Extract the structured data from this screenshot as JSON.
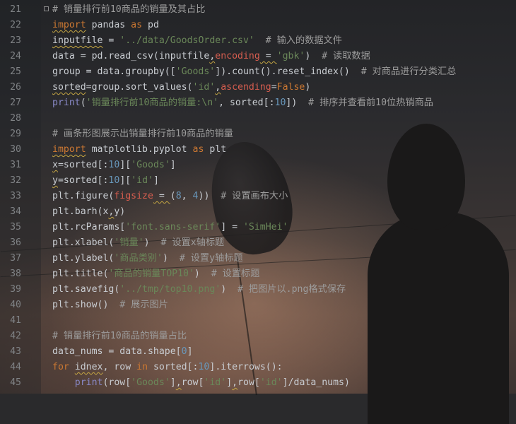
{
  "editor": {
    "lines": [
      {
        "n": "21",
        "tokens": [
          {
            "t": "# 销量排行前10商品的销量及其占比",
            "c": "cmt"
          }
        ]
      },
      {
        "n": "22",
        "tokens": [
          {
            "t": "import",
            "c": "kw wavy"
          },
          {
            "t": " pandas ",
            "c": "plain"
          },
          {
            "t": "as",
            "c": "kw"
          },
          {
            "t": " pd",
            "c": "plain"
          }
        ]
      },
      {
        "n": "23",
        "tokens": [
          {
            "t": "inputfile",
            "c": "plain wavy"
          },
          {
            "t": " = ",
            "c": "plain"
          },
          {
            "t": "'../data/GoodsOrder.csv'",
            "c": "str"
          },
          {
            "t": "  # 输入的数据文件",
            "c": "cmt"
          }
        ]
      },
      {
        "n": "24",
        "tokens": [
          {
            "t": "data = pd.read_csv(inputfile",
            "c": "plain"
          },
          {
            "t": ",",
            "c": "plain wavy"
          },
          {
            "t": "encoding",
            "c": "prm"
          },
          {
            "t": " = ",
            "c": "plain wavy"
          },
          {
            "t": "'gbk'",
            "c": "str"
          },
          {
            "t": ")  ",
            "c": "plain"
          },
          {
            "t": "# 读取数据",
            "c": "cmt"
          }
        ]
      },
      {
        "n": "25",
        "tokens": [
          {
            "t": "group = data.groupby([",
            "c": "plain"
          },
          {
            "t": "'Goods'",
            "c": "str"
          },
          {
            "t": "]).count().reset_index()  ",
            "c": "plain"
          },
          {
            "t": "# 对商品进行分类汇总",
            "c": "cmt"
          }
        ]
      },
      {
        "n": "26",
        "tokens": [
          {
            "t": "sorted",
            "c": "plain wavy"
          },
          {
            "t": "=group.sort_values(",
            "c": "plain"
          },
          {
            "t": "'id'",
            "c": "str"
          },
          {
            "t": ",",
            "c": "plain wavy"
          },
          {
            "t": "ascending",
            "c": "prm"
          },
          {
            "t": "=",
            "c": "plain"
          },
          {
            "t": "False",
            "c": "kw"
          },
          {
            "t": ")",
            "c": "plain"
          }
        ]
      },
      {
        "n": "27",
        "tokens": [
          {
            "t": "print",
            "c": "bi"
          },
          {
            "t": "(",
            "c": "plain"
          },
          {
            "t": "'销量排行前10商品的销量:\\n'",
            "c": "str"
          },
          {
            "t": ", sorted[:",
            "c": "plain"
          },
          {
            "t": "10",
            "c": "num"
          },
          {
            "t": "])  ",
            "c": "plain"
          },
          {
            "t": "# 排序并查看前10位热销商品",
            "c": "cmt"
          }
        ]
      },
      {
        "n": "28",
        "tokens": []
      },
      {
        "n": "29",
        "tokens": [
          {
            "t": "# 画条形图展示出销量排行前10商品的销量",
            "c": "cmt"
          }
        ]
      },
      {
        "n": "30",
        "tokens": [
          {
            "t": "import",
            "c": "kw wavy"
          },
          {
            "t": " matplotlib.pyplot ",
            "c": "plain"
          },
          {
            "t": "as",
            "c": "kw"
          },
          {
            "t": " plt",
            "c": "plain"
          }
        ]
      },
      {
        "n": "31",
        "tokens": [
          {
            "t": "x",
            "c": "plain wavy"
          },
          {
            "t": "=sorted[:",
            "c": "plain"
          },
          {
            "t": "10",
            "c": "num"
          },
          {
            "t": "][",
            "c": "plain"
          },
          {
            "t": "'Goods'",
            "c": "str"
          },
          {
            "t": "]",
            "c": "plain"
          }
        ]
      },
      {
        "n": "32",
        "tokens": [
          {
            "t": "y",
            "c": "plain wavy"
          },
          {
            "t": "=sorted[:",
            "c": "plain"
          },
          {
            "t": "10",
            "c": "num"
          },
          {
            "t": "][",
            "c": "plain"
          },
          {
            "t": "'id'",
            "c": "str"
          },
          {
            "t": "]",
            "c": "plain"
          }
        ]
      },
      {
        "n": "33",
        "tokens": [
          {
            "t": "plt.figure(",
            "c": "plain"
          },
          {
            "t": "figsize",
            "c": "prm"
          },
          {
            "t": " = ",
            "c": "plain wavy"
          },
          {
            "t": "(",
            "c": "plain"
          },
          {
            "t": "8",
            "c": "num"
          },
          {
            "t": ", ",
            "c": "plain"
          },
          {
            "t": "4",
            "c": "num"
          },
          {
            "t": "))  ",
            "c": "plain"
          },
          {
            "t": "# 设置画布大小",
            "c": "cmt"
          }
        ]
      },
      {
        "n": "34",
        "tokens": [
          {
            "t": "plt.barh(x",
            "c": "plain"
          },
          {
            "t": ",",
            "c": "plain wavy"
          },
          {
            "t": "y)",
            "c": "plain"
          }
        ]
      },
      {
        "n": "35",
        "tokens": [
          {
            "t": "plt.rcParams[",
            "c": "plain"
          },
          {
            "t": "'font.sans-serif'",
            "c": "str"
          },
          {
            "t": "] = ",
            "c": "plain"
          },
          {
            "t": "'SimHei'",
            "c": "str"
          }
        ]
      },
      {
        "n": "36",
        "tokens": [
          {
            "t": "plt.xlabel(",
            "c": "plain"
          },
          {
            "t": "'销量'",
            "c": "str"
          },
          {
            "t": ")  ",
            "c": "plain"
          },
          {
            "t": "# 设置x轴标题",
            "c": "cmt"
          }
        ]
      },
      {
        "n": "37",
        "tokens": [
          {
            "t": "plt.ylabel(",
            "c": "plain"
          },
          {
            "t": "'商品类别'",
            "c": "str"
          },
          {
            "t": ")  ",
            "c": "plain"
          },
          {
            "t": "# 设置y轴标题",
            "c": "cmt"
          }
        ]
      },
      {
        "n": "38",
        "tokens": [
          {
            "t": "plt.title(",
            "c": "plain"
          },
          {
            "t": "'商品的销量TOP10'",
            "c": "str"
          },
          {
            "t": ")  ",
            "c": "plain"
          },
          {
            "t": "# 设置标题",
            "c": "cmt"
          }
        ]
      },
      {
        "n": "39",
        "tokens": [
          {
            "t": "plt.savefig(",
            "c": "plain"
          },
          {
            "t": "'../tmp/top10.png'",
            "c": "str"
          },
          {
            "t": ")  ",
            "c": "plain"
          },
          {
            "t": "# 把图片以.png格式保存",
            "c": "cmt"
          }
        ]
      },
      {
        "n": "40",
        "tokens": [
          {
            "t": "plt.show()  ",
            "c": "plain"
          },
          {
            "t": "# 展示图片",
            "c": "cmt"
          }
        ]
      },
      {
        "n": "41",
        "tokens": []
      },
      {
        "n": "42",
        "tokens": [
          {
            "t": "# 销量排行前10商品的销量占比",
            "c": "cmt"
          }
        ]
      },
      {
        "n": "43",
        "tokens": [
          {
            "t": "data_nums = data.shape[",
            "c": "plain"
          },
          {
            "t": "0",
            "c": "num"
          },
          {
            "t": "]",
            "c": "plain"
          }
        ]
      },
      {
        "n": "44",
        "tokens": [
          {
            "t": "for",
            "c": "kw"
          },
          {
            "t": " ",
            "c": "plain"
          },
          {
            "t": "idnex",
            "c": "plain wavy"
          },
          {
            "t": ", row ",
            "c": "plain"
          },
          {
            "t": "in",
            "c": "kw"
          },
          {
            "t": " sorted[:",
            "c": "plain"
          },
          {
            "t": "10",
            "c": "num"
          },
          {
            "t": "].iterrows():",
            "c": "plain"
          }
        ]
      },
      {
        "n": "45",
        "tokens": [
          {
            "t": "    ",
            "c": "plain"
          },
          {
            "t": "print",
            "c": "bi"
          },
          {
            "t": "(row[",
            "c": "plain"
          },
          {
            "t": "'Goods'",
            "c": "str"
          },
          {
            "t": "]",
            "c": "plain"
          },
          {
            "t": ",",
            "c": "plain wavy"
          },
          {
            "t": "row[",
            "c": "plain"
          },
          {
            "t": "'id'",
            "c": "str"
          },
          {
            "t": "]",
            "c": "plain"
          },
          {
            "t": ",",
            "c": "plain wavy"
          },
          {
            "t": "row[",
            "c": "plain"
          },
          {
            "t": "'id'",
            "c": "str"
          },
          {
            "t": "]/data_nums)",
            "c": "plain"
          }
        ]
      }
    ]
  }
}
